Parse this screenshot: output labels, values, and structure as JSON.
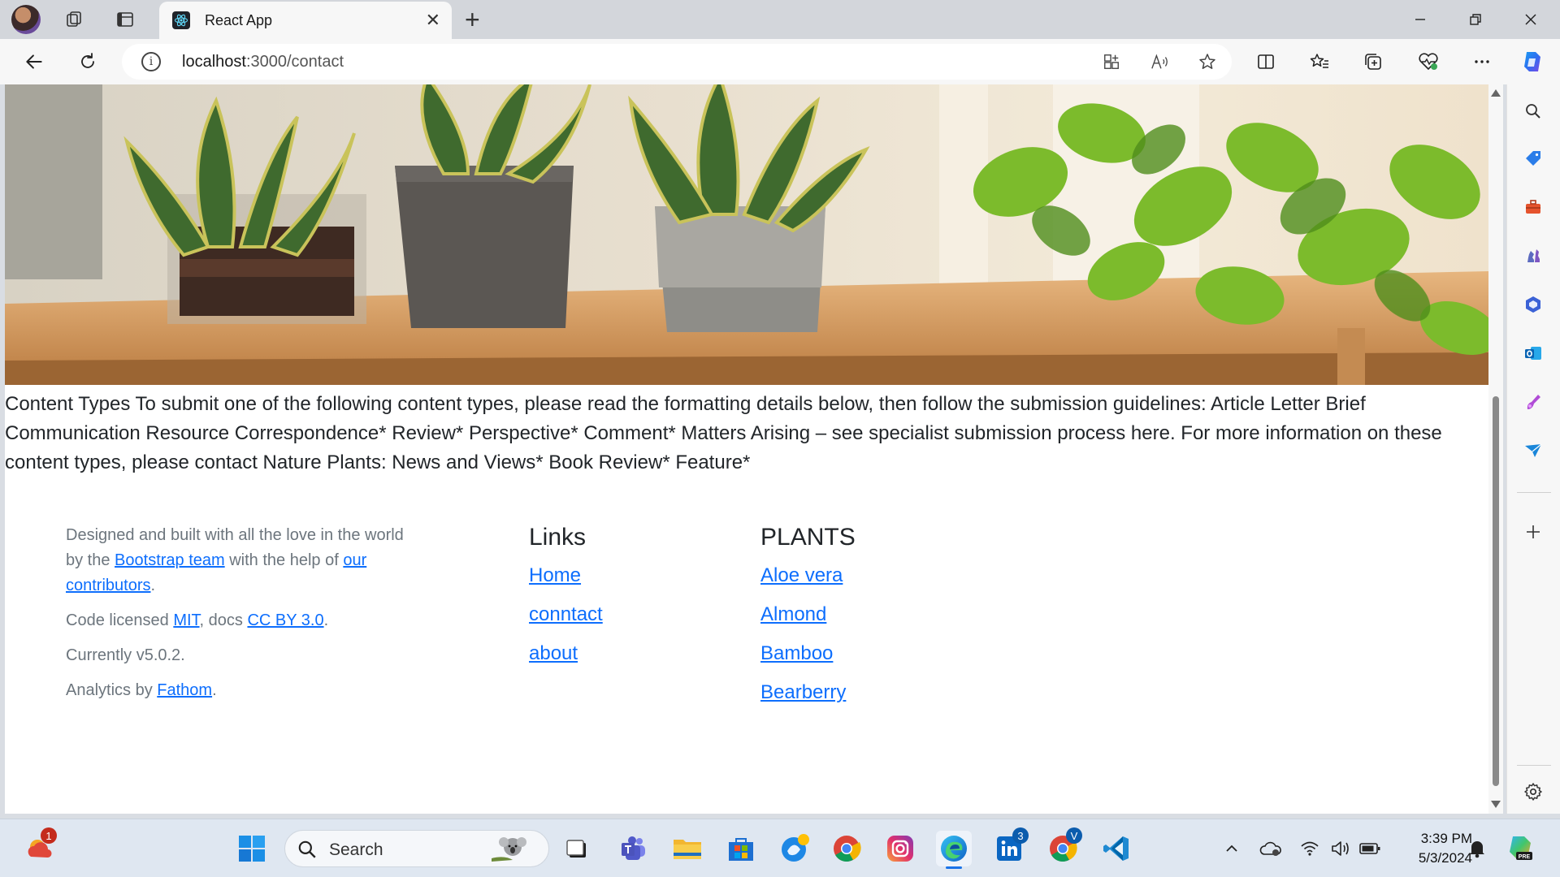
{
  "browser": {
    "tab_title": "React App",
    "url_host": "localhost",
    "url_path": ":3000/contact"
  },
  "page": {
    "content_text": "Content Types To submit one of the following content types, please read the formatting details below, then follow the submission guidelines: Article Letter Brief Communication Resource Correspondence* Review* Perspective* Comment* Matters Arising – see specialist submission process here. For more information on these content types, please contact Nature Plants: News and Views* Book Review* Feature*",
    "footer": {
      "about_p1_a": "Designed and built with all the love in the world by the ",
      "about_p1_link1": "Bootstrap team",
      "about_p1_b": " with the help of ",
      "about_p1_link2": "our contributors",
      "about_p1_c": ".",
      "about_p2_a": "Code licensed ",
      "about_p2_link1": "MIT",
      "about_p2_b": ", docs ",
      "about_p2_link2": "CC BY 3.0",
      "about_p2_c": ".",
      "about_p3": "Currently v5.0.2.",
      "about_p4_a": "Analytics by ",
      "about_p4_link": "Fathom",
      "about_p4_b": ".",
      "links_heading": "Links",
      "links": [
        "Home",
        "conntact",
        "about"
      ],
      "plants_heading": "PLANTS",
      "plants": [
        "Aloe vera",
        "Almond",
        "Bamboo",
        "Bearberry"
      ]
    }
  },
  "taskbar": {
    "search_label": "Search",
    "time": "3:39 PM",
    "date": "5/3/2024",
    "weather_badge": "1",
    "linkedin_badge": "3",
    "chrome_badge": "V"
  },
  "colors": {
    "link": "#0d6efd",
    "muted_text": "#6c757d",
    "body_text": "#212529"
  }
}
